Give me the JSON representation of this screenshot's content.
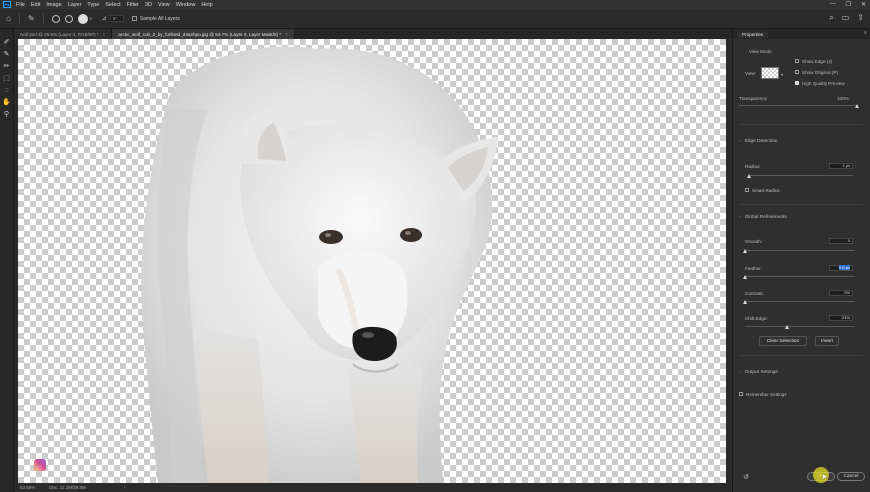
{
  "app": {
    "logo": "Ps"
  },
  "menu": [
    "File",
    "Edit",
    "Image",
    "Layer",
    "Type",
    "Select",
    "Filter",
    "3D",
    "View",
    "Window",
    "Help"
  ],
  "window_controls": [
    "—",
    "❐",
    "✕"
  ],
  "options_bar": {
    "brush_size": "5",
    "size_value": "5°",
    "sample_all_layers": "Sample All Layers"
  },
  "tabs": [
    {
      "title": "wolf.psd @ 25.6% (Layer 4, RGB/8#) *",
      "active": false
    },
    {
      "title": "arctic_wolf_cub_2_by_furlined_d4a2hpo.jpg @ 53.7% (Layer 0, Layer Mask/8) *",
      "active": true
    }
  ],
  "status": {
    "zoom": "53.68%",
    "doc": "Doc: 11.2M/39.8M"
  },
  "properties": {
    "tab": "Properties",
    "view_mode": {
      "heading": "View Mode",
      "view_label": "View:",
      "show_edge": "Show Edge (J)",
      "show_original": "Show Original (P)",
      "high_quality_preview": "High Quality Preview"
    },
    "transparency": {
      "label": "Transparency",
      "value": "100%",
      "fraction": 1.0
    },
    "edge_detection": {
      "heading": "Edge Detection",
      "radius_label": "Radius:",
      "radius_value": "1 px",
      "radius_fraction": 0.0,
      "smart_radius": "Smart Radius"
    },
    "global_refinements": {
      "heading": "Global Refinements",
      "smooth_label": "Smooth:",
      "smooth_value": "0",
      "smooth_fraction": 0.0,
      "feather_label": "Feather:",
      "feather_value": "0.0 px",
      "feather_fraction": 0.0,
      "contrast_label": "Contrast:",
      "contrast_value": "0%",
      "contrast_fraction": 0.0,
      "shift_edge_label": "Shift Edge:",
      "shift_edge_value": "-24%",
      "shift_edge_fraction": 0.38
    },
    "clear_selection": "Clear Selection",
    "invert": "Invert",
    "output_settings": "Output Settings",
    "remember_settings": "Remember Settings",
    "ok": "OK",
    "cancel": "Cancel"
  }
}
